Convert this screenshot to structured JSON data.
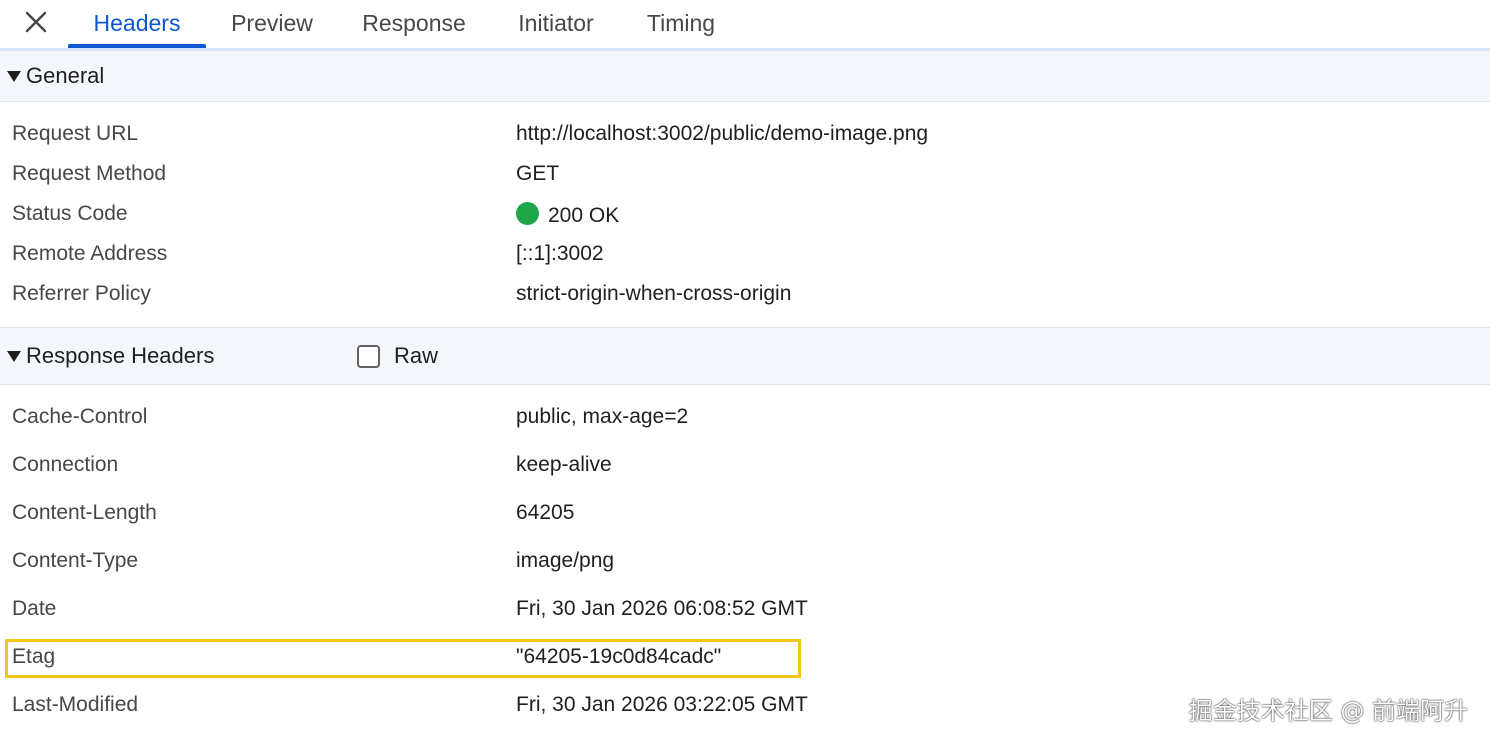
{
  "tabs": [
    {
      "label": "Headers",
      "active": true
    },
    {
      "label": "Preview",
      "active": false
    },
    {
      "label": "Response",
      "active": false
    },
    {
      "label": "Initiator",
      "active": false
    },
    {
      "label": "Timing",
      "active": false
    }
  ],
  "general": {
    "title": "General",
    "rows": [
      {
        "key": "Request URL",
        "value": "http://localhost:3002/public/demo-image.png"
      },
      {
        "key": "Request Method",
        "value": "GET"
      },
      {
        "key": "Status Code",
        "value": "200 OK"
      },
      {
        "key": "Remote Address",
        "value": "[::1]:3002"
      },
      {
        "key": "Referrer Policy",
        "value": "strict-origin-when-cross-origin"
      }
    ]
  },
  "response_headers": {
    "title": "Response Headers",
    "raw_label": "Raw",
    "raw_checked": false,
    "rows": [
      {
        "key": "Cache-Control",
        "value": "public, max-age=2"
      },
      {
        "key": "Connection",
        "value": "keep-alive"
      },
      {
        "key": "Content-Length",
        "value": "64205"
      },
      {
        "key": "Content-Type",
        "value": "image/png"
      },
      {
        "key": "Date",
        "value": "Fri, 30 Jan 2026 06:08:52 GMT"
      },
      {
        "key": "Etag",
        "value": "\"64205-19c0d84cadc\""
      },
      {
        "key": "Last-Modified",
        "value": "Fri, 30 Jan 2026 03:22:05 GMT"
      }
    ]
  },
  "status_color": "#1fa64a",
  "accent_color": "#0b57d0",
  "highlight_color": "#f5c518",
  "watermark": "掘金技术社区 @ 前端阿升"
}
